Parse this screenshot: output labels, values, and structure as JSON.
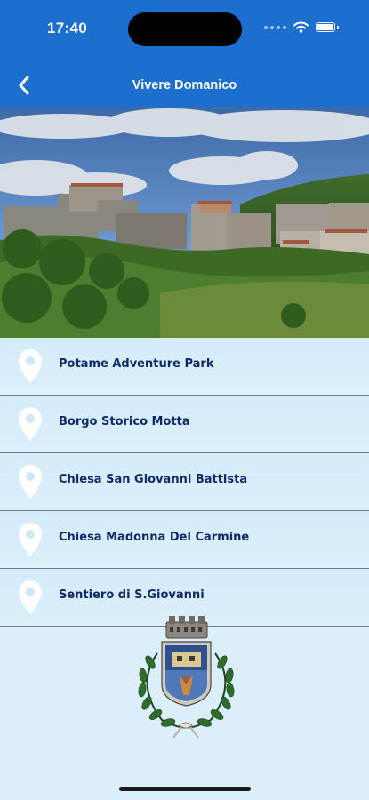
{
  "status_bar": {
    "time": "17:40"
  },
  "nav": {
    "title": "Vivere Domanico"
  },
  "places": [
    {
      "label": "Potame Adventure Park"
    },
    {
      "label": "Borgo Storico Motta"
    },
    {
      "label": "Chiesa San Giovanni Battista"
    },
    {
      "label": "Chiesa Madonna Del Carmine"
    },
    {
      "label": "Sentiero di S.Giovanni"
    }
  ],
  "colors": {
    "header": "#1c6fce",
    "list_text": "#0f2a6b",
    "background": "#dbeefa"
  },
  "icons": {
    "back": "chevron-left-icon",
    "place": "map-pin-icon",
    "wifi": "wifi-icon",
    "battery": "battery-icon"
  }
}
